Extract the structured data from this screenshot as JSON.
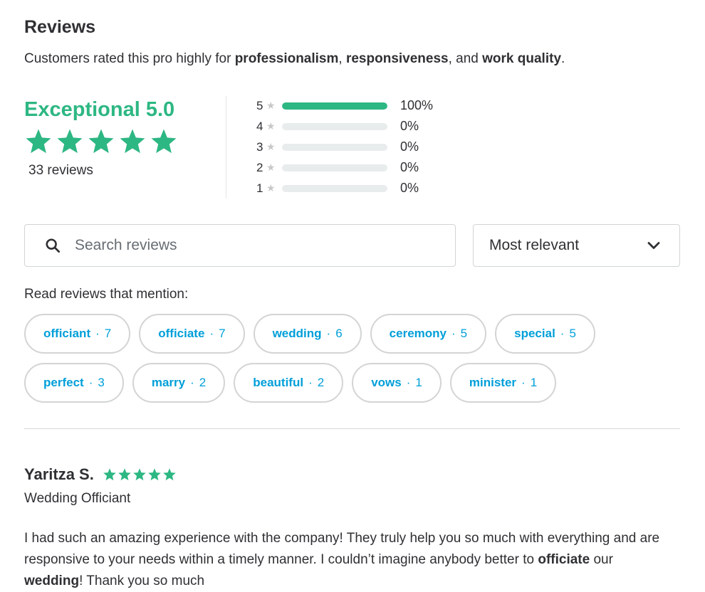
{
  "header": {
    "title": "Reviews",
    "summary_prefix": "Customers rated this pro highly for ",
    "summary_trait_1": "professionalism",
    "summary_sep_1": ", ",
    "summary_trait_2": "responsiveness",
    "summary_sep_2": ", and ",
    "summary_trait_3": "work quality",
    "summary_suffix": "."
  },
  "rating": {
    "label": "Exceptional 5.0",
    "stars": 5,
    "count_text": "33 reviews",
    "accent_color": "#2db783"
  },
  "histogram": [
    {
      "stars": "5",
      "fraction": 1.0,
      "percent": "100%"
    },
    {
      "stars": "4",
      "fraction": 0.0,
      "percent": "0%"
    },
    {
      "stars": "3",
      "fraction": 0.0,
      "percent": "0%"
    },
    {
      "stars": "2",
      "fraction": 0.0,
      "percent": "0%"
    },
    {
      "stars": "1",
      "fraction": 0.0,
      "percent": "0%"
    }
  ],
  "search": {
    "placeholder": "Search reviews",
    "value": "",
    "icon": "search-icon"
  },
  "sort": {
    "selected": "Most relevant",
    "icon": "chevron-down-icon"
  },
  "mentions": {
    "label": "Read reviews that mention:",
    "chip_color": "#009fd9",
    "rows": [
      [
        {
          "word": "officiant",
          "count": "7"
        },
        {
          "word": "officiate",
          "count": "7"
        },
        {
          "word": "wedding",
          "count": "6"
        },
        {
          "word": "ceremony",
          "count": "5"
        },
        {
          "word": "special",
          "count": "5"
        }
      ],
      [
        {
          "word": "perfect",
          "count": "3"
        },
        {
          "word": "marry",
          "count": "2"
        },
        {
          "word": "beautiful",
          "count": "2"
        },
        {
          "word": "vows",
          "count": "1"
        },
        {
          "word": "minister",
          "count": "1"
        }
      ]
    ]
  },
  "review": {
    "author": "Yaritza S.",
    "stars": 5,
    "service": "Wedding Officiant",
    "text_1": "I had such an amazing experience with the company! They truly help you so much with everything and are responsive to your needs within a timely manner. I couldn’t imagine anybody better to ",
    "bold_1": "officiate",
    "text_2": " our ",
    "bold_2": "wedding",
    "text_3": "! Thank you so much"
  }
}
